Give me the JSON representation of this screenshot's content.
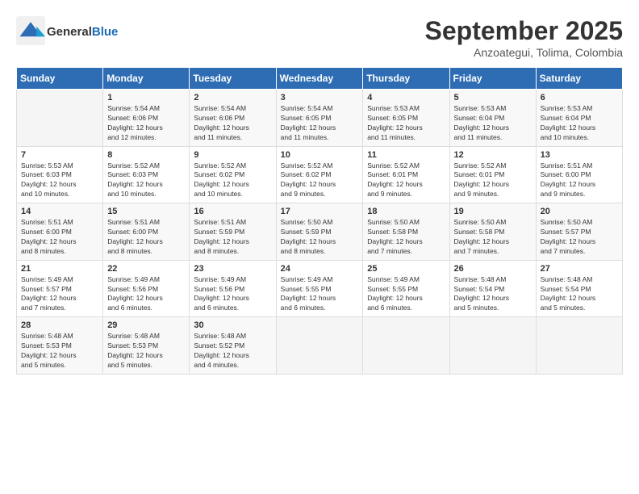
{
  "header": {
    "logo_general": "General",
    "logo_blue": "Blue",
    "month_title": "September 2025",
    "location": "Anzoategui, Tolima, Colombia"
  },
  "days_of_week": [
    "Sunday",
    "Monday",
    "Tuesday",
    "Wednesday",
    "Thursday",
    "Friday",
    "Saturday"
  ],
  "weeks": [
    {
      "days": [
        {
          "number": "",
          "info": ""
        },
        {
          "number": "1",
          "info": "Sunrise: 5:54 AM\nSunset: 6:06 PM\nDaylight: 12 hours\nand 12 minutes."
        },
        {
          "number": "2",
          "info": "Sunrise: 5:54 AM\nSunset: 6:06 PM\nDaylight: 12 hours\nand 11 minutes."
        },
        {
          "number": "3",
          "info": "Sunrise: 5:54 AM\nSunset: 6:05 PM\nDaylight: 12 hours\nand 11 minutes."
        },
        {
          "number": "4",
          "info": "Sunrise: 5:53 AM\nSunset: 6:05 PM\nDaylight: 12 hours\nand 11 minutes."
        },
        {
          "number": "5",
          "info": "Sunrise: 5:53 AM\nSunset: 6:04 PM\nDaylight: 12 hours\nand 11 minutes."
        },
        {
          "number": "6",
          "info": "Sunrise: 5:53 AM\nSunset: 6:04 PM\nDaylight: 12 hours\nand 10 minutes."
        }
      ]
    },
    {
      "days": [
        {
          "number": "7",
          "info": "Sunrise: 5:53 AM\nSunset: 6:03 PM\nDaylight: 12 hours\nand 10 minutes."
        },
        {
          "number": "8",
          "info": "Sunrise: 5:52 AM\nSunset: 6:03 PM\nDaylight: 12 hours\nand 10 minutes."
        },
        {
          "number": "9",
          "info": "Sunrise: 5:52 AM\nSunset: 6:02 PM\nDaylight: 12 hours\nand 10 minutes."
        },
        {
          "number": "10",
          "info": "Sunrise: 5:52 AM\nSunset: 6:02 PM\nDaylight: 12 hours\nand 9 minutes."
        },
        {
          "number": "11",
          "info": "Sunrise: 5:52 AM\nSunset: 6:01 PM\nDaylight: 12 hours\nand 9 minutes."
        },
        {
          "number": "12",
          "info": "Sunrise: 5:52 AM\nSunset: 6:01 PM\nDaylight: 12 hours\nand 9 minutes."
        },
        {
          "number": "13",
          "info": "Sunrise: 5:51 AM\nSunset: 6:00 PM\nDaylight: 12 hours\nand 9 minutes."
        }
      ]
    },
    {
      "days": [
        {
          "number": "14",
          "info": "Sunrise: 5:51 AM\nSunset: 6:00 PM\nDaylight: 12 hours\nand 8 minutes."
        },
        {
          "number": "15",
          "info": "Sunrise: 5:51 AM\nSunset: 6:00 PM\nDaylight: 12 hours\nand 8 minutes."
        },
        {
          "number": "16",
          "info": "Sunrise: 5:51 AM\nSunset: 5:59 PM\nDaylight: 12 hours\nand 8 minutes."
        },
        {
          "number": "17",
          "info": "Sunrise: 5:50 AM\nSunset: 5:59 PM\nDaylight: 12 hours\nand 8 minutes."
        },
        {
          "number": "18",
          "info": "Sunrise: 5:50 AM\nSunset: 5:58 PM\nDaylight: 12 hours\nand 7 minutes."
        },
        {
          "number": "19",
          "info": "Sunrise: 5:50 AM\nSunset: 5:58 PM\nDaylight: 12 hours\nand 7 minutes."
        },
        {
          "number": "20",
          "info": "Sunrise: 5:50 AM\nSunset: 5:57 PM\nDaylight: 12 hours\nand 7 minutes."
        }
      ]
    },
    {
      "days": [
        {
          "number": "21",
          "info": "Sunrise: 5:49 AM\nSunset: 5:57 PM\nDaylight: 12 hours\nand 7 minutes."
        },
        {
          "number": "22",
          "info": "Sunrise: 5:49 AM\nSunset: 5:56 PM\nDaylight: 12 hours\nand 6 minutes."
        },
        {
          "number": "23",
          "info": "Sunrise: 5:49 AM\nSunset: 5:56 PM\nDaylight: 12 hours\nand 6 minutes."
        },
        {
          "number": "24",
          "info": "Sunrise: 5:49 AM\nSunset: 5:55 PM\nDaylight: 12 hours\nand 6 minutes."
        },
        {
          "number": "25",
          "info": "Sunrise: 5:49 AM\nSunset: 5:55 PM\nDaylight: 12 hours\nand 6 minutes."
        },
        {
          "number": "26",
          "info": "Sunrise: 5:48 AM\nSunset: 5:54 PM\nDaylight: 12 hours\nand 5 minutes."
        },
        {
          "number": "27",
          "info": "Sunrise: 5:48 AM\nSunset: 5:54 PM\nDaylight: 12 hours\nand 5 minutes."
        }
      ]
    },
    {
      "days": [
        {
          "number": "28",
          "info": "Sunrise: 5:48 AM\nSunset: 5:53 PM\nDaylight: 12 hours\nand 5 minutes."
        },
        {
          "number": "29",
          "info": "Sunrise: 5:48 AM\nSunset: 5:53 PM\nDaylight: 12 hours\nand 5 minutes."
        },
        {
          "number": "30",
          "info": "Sunrise: 5:48 AM\nSunset: 5:52 PM\nDaylight: 12 hours\nand 4 minutes."
        },
        {
          "number": "",
          "info": ""
        },
        {
          "number": "",
          "info": ""
        },
        {
          "number": "",
          "info": ""
        },
        {
          "number": "",
          "info": ""
        }
      ]
    }
  ]
}
